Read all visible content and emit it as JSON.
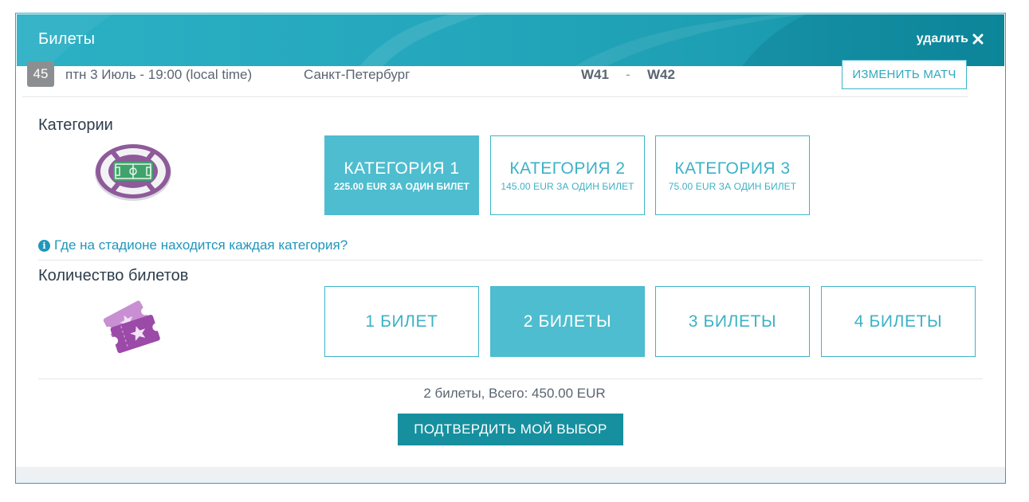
{
  "header": {
    "title": "Билеты",
    "delete_label": "удалить",
    "delete_icon": "close-icon"
  },
  "match": {
    "number": "45",
    "date": "птн 3 Июль - 19:00 (local time)",
    "city": "Санкт-Петербург",
    "team_a": "W41",
    "separator": "-",
    "team_b": "W42",
    "change_label": "ИЗМЕНИТЬ МАТЧ"
  },
  "categories": {
    "label": "Категории",
    "icon": "stadium-icon",
    "items": [
      {
        "title": "КАТЕГОРИЯ 1",
        "price": "225.00 EUR ЗА ОДИН БИЛЕТ",
        "selected": true
      },
      {
        "title": "КАТЕГОРИЯ 2",
        "price": "145.00 EUR ЗА ОДИН БИЛЕТ",
        "selected": false
      },
      {
        "title": "КАТЕГОРИЯ 3",
        "price": "75.00 EUR ЗА ОДИН БИЛЕТ",
        "selected": false
      }
    ],
    "info_link": "Где на стадионе находится каждая категория?",
    "info_icon": "info-icon"
  },
  "quantity": {
    "label": "Количество билетов",
    "icon": "tickets-icon",
    "items": [
      {
        "label": "1 БИЛЕТ",
        "selected": false
      },
      {
        "label": "2 БИЛЕТЫ",
        "selected": true
      },
      {
        "label": "3 БИЛЕТЫ",
        "selected": false
      },
      {
        "label": "4 БИЛЕТЫ",
        "selected": false
      }
    ]
  },
  "summary": {
    "text": "2 билеты, Всего: 450.00 EUR"
  },
  "confirm": {
    "label": "ПОДТВЕРДИТЬ МОЙ ВЫБОР"
  },
  "colors": {
    "accent": "#4ebdcf",
    "header": "#25a8bd",
    "confirm": "#16909f",
    "link": "#2196bd"
  }
}
